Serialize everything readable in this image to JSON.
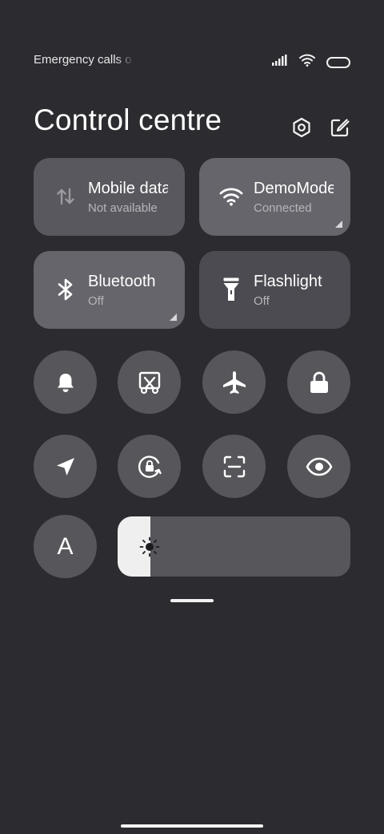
{
  "status_bar": {
    "carrier_text": "Emergency calls o",
    "icons": [
      "signal-icon",
      "wifi-icon",
      "battery-icon"
    ]
  },
  "header": {
    "title": "Control centre",
    "actions": [
      "settings-icon",
      "edit-icon"
    ]
  },
  "tiles": [
    {
      "label": "Mobile data",
      "status": "Not available",
      "icon": "mobile-data-icon"
    },
    {
      "label": "DemoMode",
      "status": "Connected",
      "icon": "wifi-icon"
    },
    {
      "label": "Bluetooth",
      "status": "Off",
      "icon": "bluetooth-icon"
    },
    {
      "label": "Flashlight",
      "status": "Off",
      "icon": "flashlight-icon"
    }
  ],
  "toggles": [
    {
      "icon": "bell-icon"
    },
    {
      "icon": "screenshot-icon"
    },
    {
      "icon": "airplane-icon"
    },
    {
      "icon": "lock-icon"
    },
    {
      "icon": "location-icon"
    },
    {
      "icon": "rotation-lock-icon"
    },
    {
      "icon": "scanner-icon"
    },
    {
      "icon": "eye-icon"
    },
    {
      "icon": "font-icon",
      "label": "A"
    }
  ],
  "brightness": {
    "level": 0.14,
    "icon": "brightness-icon"
  },
  "colors": {
    "background": "#2b2b30",
    "tile": "#58585e",
    "round_button": "#56565b",
    "brightness_fill": "#efefef"
  }
}
